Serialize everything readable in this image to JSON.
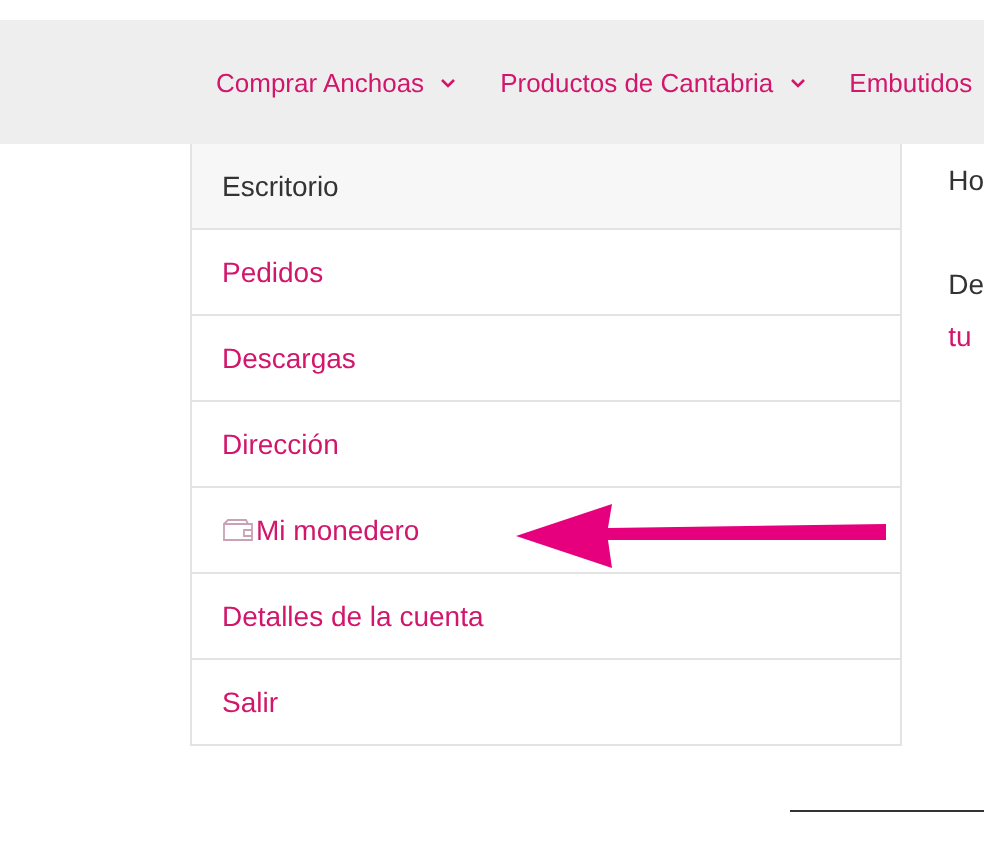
{
  "nav": [
    {
      "label": "Comprar Anchoas",
      "caret": true
    },
    {
      "label": "Productos de Cantabria",
      "caret": true
    },
    {
      "label": "Embutidos",
      "caret": false
    }
  ],
  "account_menu": [
    {
      "label": "Escritorio",
      "selected": true,
      "kind": "text"
    },
    {
      "label": "Pedidos",
      "selected": false,
      "kind": "text"
    },
    {
      "label": "Descargas",
      "selected": false,
      "kind": "text"
    },
    {
      "label": "Dirección",
      "selected": false,
      "kind": "text"
    },
    {
      "label": "Mi monedero",
      "selected": false,
      "kind": "wallet"
    },
    {
      "label": "Detalles de la cuenta",
      "selected": false,
      "kind": "text"
    },
    {
      "label": "Salir",
      "selected": false,
      "kind": "text"
    }
  ],
  "content": [
    {
      "text": "Ho",
      "kind": "text"
    },
    {
      "text": "De",
      "kind": "text"
    },
    {
      "text": "tu",
      "kind": "link"
    }
  ]
}
